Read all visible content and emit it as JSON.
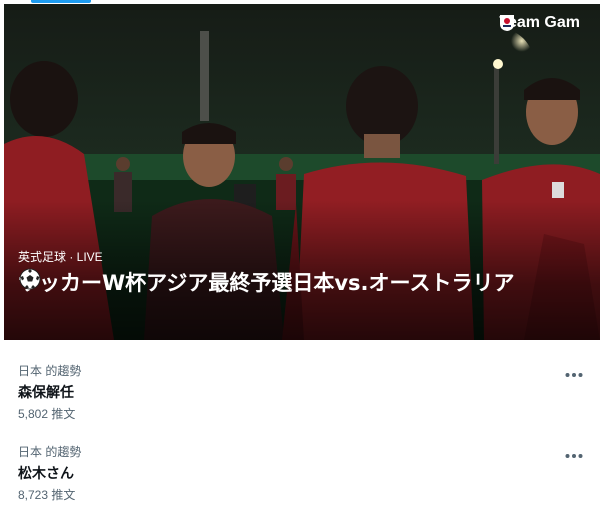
{
  "brand": {
    "label": "Team Gam"
  },
  "hero": {
    "meta": "英式足球 · LIVE",
    "title_before_emoji": "サッカーW杯アジア最終予選",
    "title_after_emoji": "日本vs.オーストラリア"
  },
  "trends": [
    {
      "context": "日本 的趨勢",
      "name": "森保解任",
      "count": "5,802 推文"
    },
    {
      "context": "日本 的趨勢",
      "name": "松木さん",
      "count": "8,723 推文"
    }
  ],
  "colors": {
    "accent": "#1d9bf0",
    "text_primary": "#0f1419",
    "text_secondary": "#536471",
    "jersey_red": "#8f1d22"
  },
  "icons": {
    "more": "more-horizontal-icon",
    "ball": "soccer-ball-icon",
    "brand_mark": "japan-football-crest-icon"
  }
}
